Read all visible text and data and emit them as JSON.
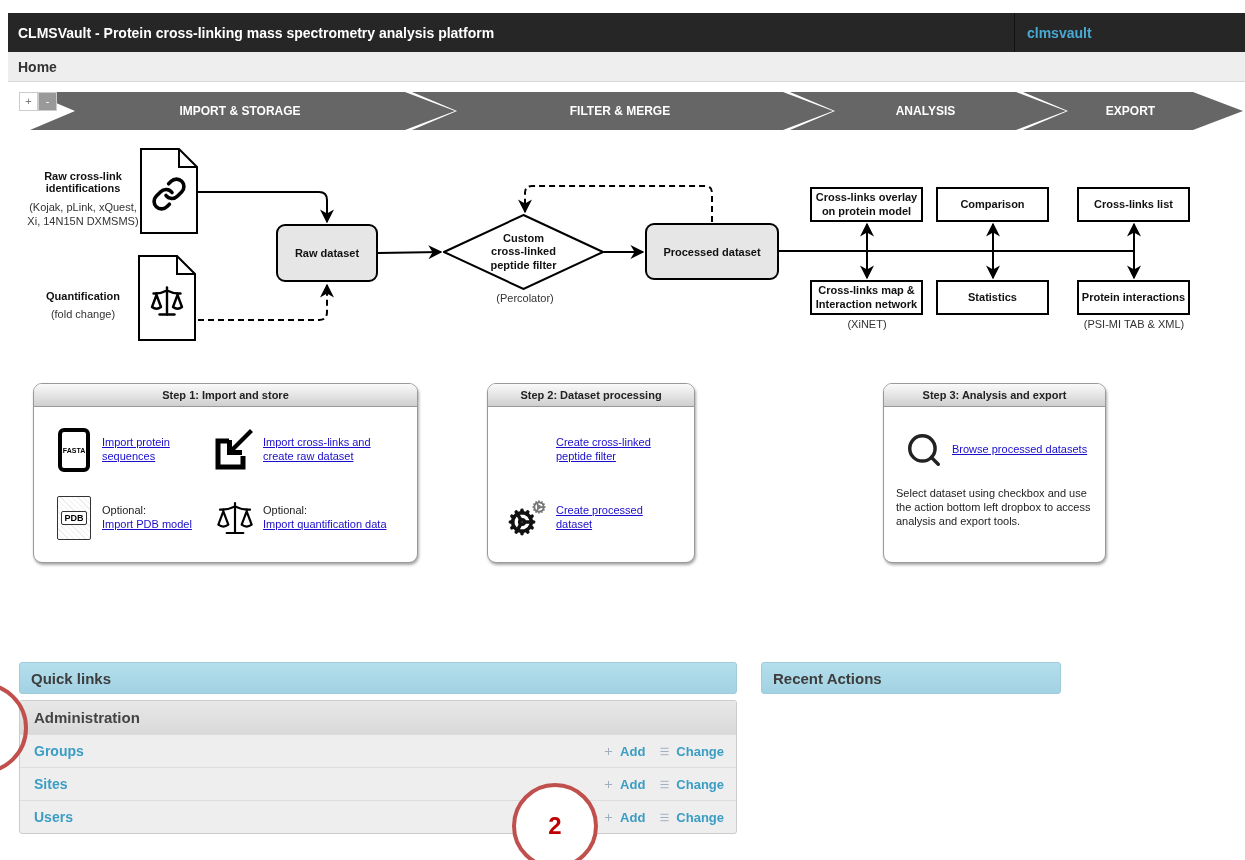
{
  "header": {
    "title": "CLMSVault - Protein cross-linking mass spectrometry analysis platform",
    "user": "clmsvault"
  },
  "breadcrumb": "Home",
  "zoom_controls": [
    {
      "label": "+",
      "disabled": false
    },
    {
      "label": "-",
      "disabled": true
    }
  ],
  "pipeline": [
    {
      "label": "IMPORT & STORAGE"
    },
    {
      "label": "FILTER & MERGE"
    },
    {
      "label": "ANALYSIS"
    },
    {
      "label": "EXPORT"
    }
  ],
  "workflow": {
    "inputs": [
      {
        "kind": "links",
        "label": "Raw cross-link identifications",
        "note": "(Kojak, pLink, xQuest, Xi, 14N15N DXMSMS)"
      },
      {
        "kind": "scale",
        "label": "Quantification",
        "note": "(fold change)"
      }
    ],
    "raw_dataset": "Raw dataset",
    "filter": {
      "label": "Custom cross-linked peptide filter",
      "note": "(Percolator)"
    },
    "processed_dataset": "Processed dataset",
    "outputs": [
      {
        "label": "Cross-links overlay on protein model"
      },
      {
        "label": "Comparison"
      },
      {
        "label": "Cross-links list"
      },
      {
        "label": "Cross-links map & Interaction network",
        "note": "(XiNET)"
      },
      {
        "label": "Statistics"
      },
      {
        "label": "Protein interactions",
        "note": "(PSI-MI TAB & XML)"
      }
    ]
  },
  "steps": [
    {
      "title": "Step 1: Import and store",
      "items": [
        {
          "kind": "fasta",
          "icon_text": "FASTA",
          "link": "Import protein sequences"
        },
        {
          "kind": "import",
          "link": "Import cross-links and create raw dataset"
        },
        {
          "kind": "pdb",
          "icon_text": "PDB",
          "prefix": "Optional:",
          "link": "Import PDB model"
        },
        {
          "kind": "scale",
          "prefix": "Optional:",
          "link": "Import quantification data"
        }
      ]
    },
    {
      "title": "Step 2: Dataset processing",
      "items": [
        {
          "kind": "plain",
          "link": "Create cross-linked peptide filter"
        },
        {
          "kind": "gears",
          "link": "Create processed dataset"
        }
      ]
    },
    {
      "title": "Step 3: Analysis and export",
      "items": [
        {
          "kind": "search",
          "link": "Browse processed datasets"
        }
      ],
      "description": "Select dataset using checkbox and use the action bottom left dropbox to access analysis and export tools."
    }
  ],
  "quick_links": "Quick links",
  "recent_actions": "Recent Actions",
  "admin": {
    "title": "Administration",
    "rows": [
      {
        "name": "Groups",
        "add": "Add",
        "change": "Change"
      },
      {
        "name": "Sites",
        "add": "Add",
        "change": "Change"
      },
      {
        "name": "Users",
        "add": "Add",
        "change": "Change"
      }
    ]
  },
  "callouts": [
    {
      "kind": "ring"
    },
    {
      "kind": "numbered",
      "label": "2"
    }
  ]
}
